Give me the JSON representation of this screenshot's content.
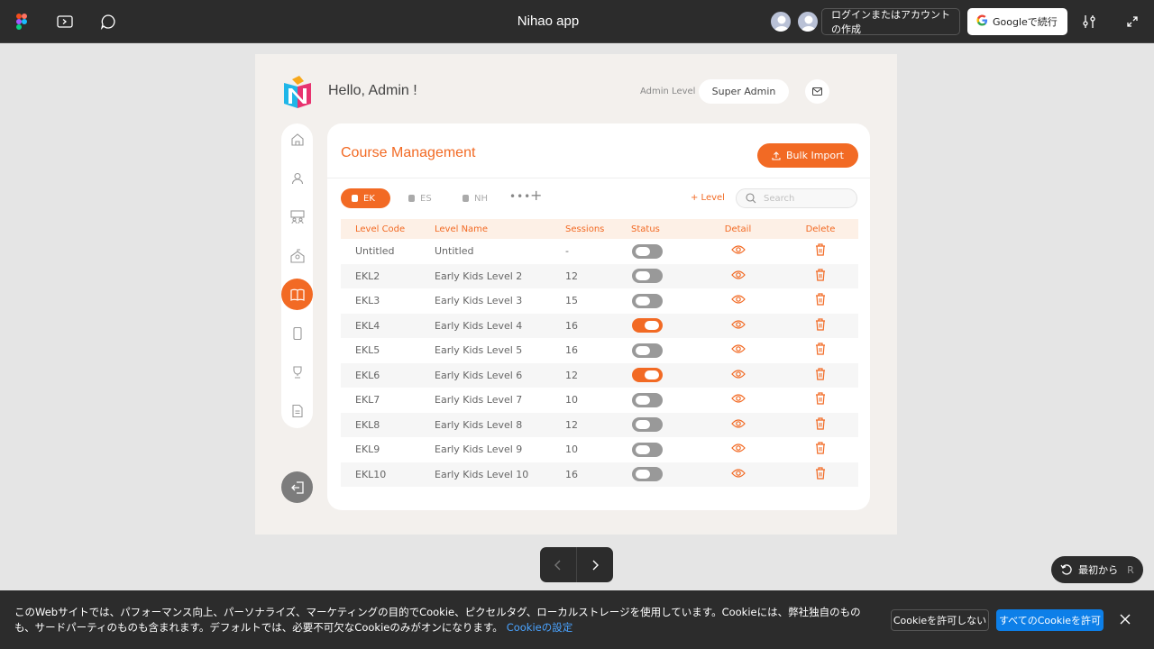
{
  "topbar": {
    "title": "Nihao app",
    "login_label": "ログインまたはアカウントの作成",
    "google_label": "Googleで続行",
    "icons": [
      "figma-logo-icon",
      "present-icon",
      "comment-icon",
      "settings-sliders-icon",
      "expand-icon"
    ]
  },
  "header": {
    "greeting": "Hello, Admin !",
    "admin_level_label": "Admin Level",
    "admin_level_value": "Super Admin"
  },
  "sidebar": {
    "items": [
      {
        "icon": "home-icon",
        "active": false
      },
      {
        "icon": "user-icon",
        "active": false
      },
      {
        "icon": "classroom-icon",
        "active": false
      },
      {
        "icon": "school-icon",
        "active": false
      },
      {
        "icon": "book-icon",
        "active": true
      },
      {
        "icon": "mobile-icon",
        "active": false
      },
      {
        "icon": "trophy-icon",
        "active": false
      },
      {
        "icon": "document-icon",
        "active": false
      }
    ]
  },
  "card": {
    "title": "Course Management",
    "bulk_import_label": "Bulk Import",
    "tabs": [
      {
        "label": "EK",
        "active": true
      },
      {
        "label": "ES",
        "active": false
      },
      {
        "label": "NH",
        "active": false
      }
    ],
    "more_label": "•••",
    "add_tab_label": "+",
    "add_level_label": "+ Level",
    "search_placeholder": "Search"
  },
  "table": {
    "headers": [
      "Level Code",
      "Level Name",
      "Sessions",
      "Status",
      "Detail",
      "Delete"
    ],
    "rows": [
      {
        "code": "Untitled",
        "name": "Untitled",
        "sessions": "-",
        "status": false
      },
      {
        "code": "EKL2",
        "name": "Early Kids Level 2",
        "sessions": "12",
        "status": false
      },
      {
        "code": "EKL3",
        "name": "Early Kids Level 3",
        "sessions": "15",
        "status": false
      },
      {
        "code": "EKL4",
        "name": "Early Kids Level 4",
        "sessions": "16",
        "status": true
      },
      {
        "code": "EKL5",
        "name": "Early Kids Level 5",
        "sessions": "16",
        "status": false
      },
      {
        "code": "EKL6",
        "name": "Early Kids Level 6",
        "sessions": "12",
        "status": true
      },
      {
        "code": "EKL7",
        "name": "Early Kids Level 7",
        "sessions": "10",
        "status": false
      },
      {
        "code": "EKL8",
        "name": "Early Kids Level 8",
        "sessions": "12",
        "status": false
      },
      {
        "code": "EKL9",
        "name": "Early Kids Level 9",
        "sessions": "10",
        "status": false
      },
      {
        "code": "EKL10",
        "name": "Early Kids Level 10",
        "sessions": "16",
        "status": false
      }
    ]
  },
  "player": {
    "restart_label": "最初から",
    "restart_key": "R"
  },
  "cookie": {
    "text": "このWebサイトでは、パフォーマンス向上、パーソナライズ、マーケティングの目的でCookie、ピクセルタグ、ローカルストレージを使用しています。Cookieには、弊社独自のものも、サードパーティのものも含まれます。デフォルトでは、必要不可欠なCookieのみがオンになります。",
    "settings_link": "Cookieの設定",
    "deny_label": "Cookieを許可しない",
    "allow_label": "すべてのCookieを許可"
  },
  "colors": {
    "accent": "#f26a24",
    "topbar": "#2c2c2c",
    "frame_bg": "#f3f0ed",
    "allow_button": "#0d7fe8"
  }
}
